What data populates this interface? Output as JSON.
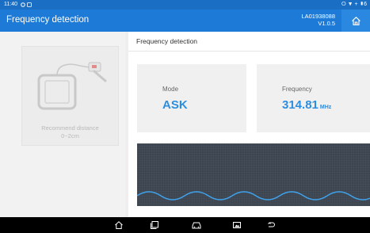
{
  "status_bar": {
    "time": "11:40",
    "right_icons": "⭘ ▼ + ▮6"
  },
  "app_bar": {
    "title": "Frequency detection",
    "serial": "LA01938088",
    "version": "V1.0.5",
    "home_icon": "home-icon"
  },
  "left_panel": {
    "recommend_label": "Recommend distance",
    "recommend_value": "0~2cm"
  },
  "main": {
    "section_title": "Frequency detection",
    "mode": {
      "label": "Mode",
      "value": "ASK"
    },
    "frequency": {
      "label": "Frequency",
      "value": "314.81",
      "unit": "MHz"
    }
  },
  "nav_bar": {
    "icons": [
      "home-icon",
      "recent-apps-icon",
      "car-diagnose-icon",
      "screenshot-icon",
      "back-icon"
    ]
  },
  "colors": {
    "accent": "#2c8ee0",
    "appbar": "#1d7ad6",
    "waveform_bg": "#3d4650",
    "wave_line": "#3fa3ee"
  }
}
